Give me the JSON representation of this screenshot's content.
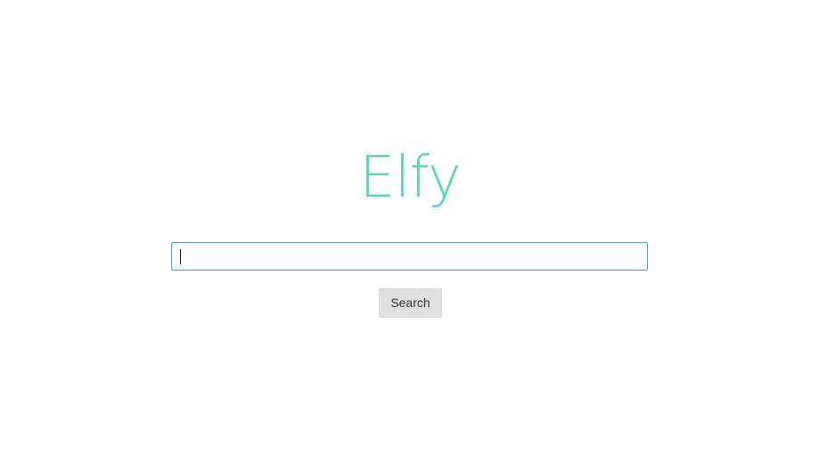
{
  "logo": {
    "text": "Elfy",
    "color": "#5cd6bd"
  },
  "search": {
    "value": "",
    "placeholder": "",
    "border_color": "#3f9fd8"
  },
  "search_button": {
    "label": "Search",
    "background": "#e0e0e0"
  }
}
